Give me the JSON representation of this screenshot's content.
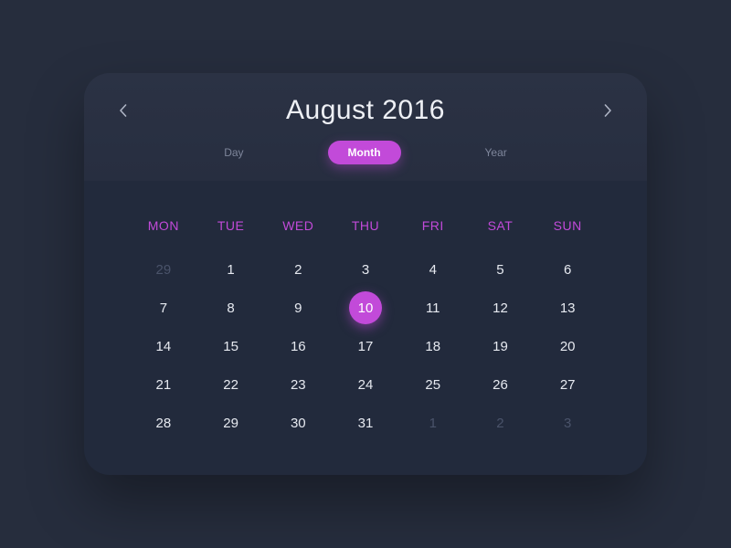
{
  "colors": {
    "accent": "#c24ad9",
    "bg": "#262d3d",
    "card": "#222a3c"
  },
  "header": {
    "title": "August 2016",
    "prev_aria": "Previous",
    "next_aria": "Next"
  },
  "tabs": {
    "day": "Day",
    "month": "Month",
    "year": "Year",
    "active": "month"
  },
  "dow": [
    "MON",
    "TUE",
    "WED",
    "THU",
    "FRI",
    "SAT",
    "SUN"
  ],
  "weeks": [
    [
      {
        "n": 29,
        "muted": true
      },
      {
        "n": 1
      },
      {
        "n": 2
      },
      {
        "n": 3
      },
      {
        "n": 4
      },
      {
        "n": 5
      },
      {
        "n": 6
      }
    ],
    [
      {
        "n": 7
      },
      {
        "n": 8
      },
      {
        "n": 9
      },
      {
        "n": 10,
        "selected": true
      },
      {
        "n": 11
      },
      {
        "n": 12
      },
      {
        "n": 13
      }
    ],
    [
      {
        "n": 14
      },
      {
        "n": 15
      },
      {
        "n": 16
      },
      {
        "n": 17
      },
      {
        "n": 18
      },
      {
        "n": 19
      },
      {
        "n": 20
      }
    ],
    [
      {
        "n": 21
      },
      {
        "n": 22
      },
      {
        "n": 23
      },
      {
        "n": 24
      },
      {
        "n": 25
      },
      {
        "n": 26
      },
      {
        "n": 27
      }
    ],
    [
      {
        "n": 28
      },
      {
        "n": 29
      },
      {
        "n": 30
      },
      {
        "n": 31
      },
      {
        "n": 1,
        "muted": true
      },
      {
        "n": 2,
        "muted": true
      },
      {
        "n": 3,
        "muted": true
      }
    ]
  ]
}
